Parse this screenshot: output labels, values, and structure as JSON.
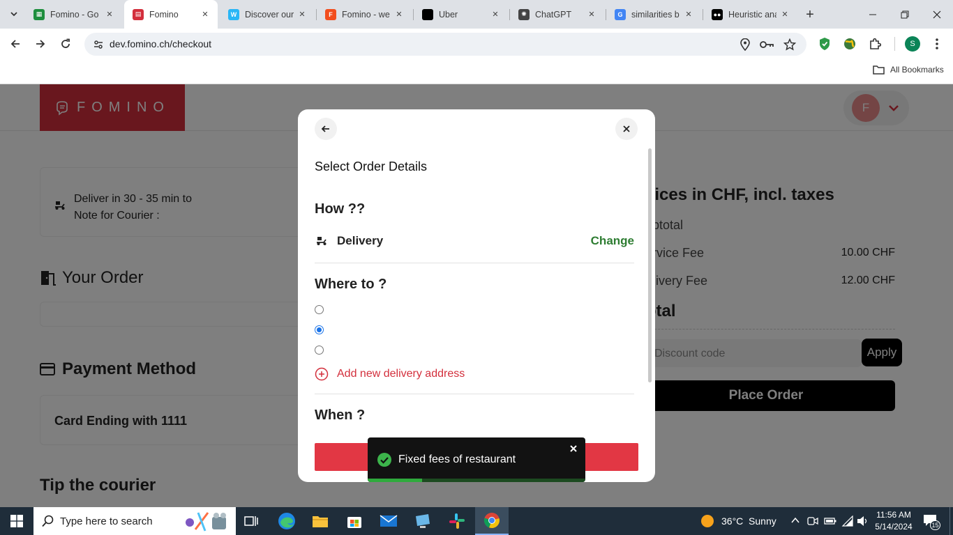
{
  "browser": {
    "tabs": [
      {
        "title": "Fomino - Go",
        "icon": "google-sheets-icon",
        "color": "#1e8e3e",
        "glyph": "▦"
      },
      {
        "title": "Fomino",
        "icon": "fomino-icon",
        "color": "#d32f3c",
        "glyph": "▤"
      },
      {
        "title": "Discover our",
        "icon": "webflow-icon",
        "color": "#29b6f6",
        "glyph": "W"
      },
      {
        "title": "Fomino - we",
        "icon": "figma-icon",
        "color": "#f24e1e",
        "glyph": "F"
      },
      {
        "title": "Uber",
        "icon": "uber-icon",
        "color": "#000000",
        "glyph": ""
      },
      {
        "title": "ChatGPT",
        "icon": "chatgpt-icon",
        "color": "#444444",
        "glyph": "✺"
      },
      {
        "title": "similarities b",
        "icon": "google-icon",
        "color": "#4285f4",
        "glyph": "G"
      },
      {
        "title": "Heuristic ana",
        "icon": "medium-icon",
        "color": "#000000",
        "glyph": "●●"
      }
    ],
    "url": "dev.fomino.ch/checkout",
    "all_bookmarks": "All Bookmarks",
    "profile_initial": "S"
  },
  "site": {
    "logo": "FOMINO",
    "user_initial": "F",
    "deliver_text": "Deliver in 30 - 35 min to",
    "courier_note": "Note for Courier :",
    "your_order": "Your Order",
    "payment_method": "Payment Method",
    "card_text": "Card Ending with 1111",
    "tip_title": "Tip the courier"
  },
  "summary": {
    "title": "Prices in CHF, incl. taxes",
    "subtotal_label": "Subtotal",
    "service_fee_label": "Service Fee",
    "service_fee_value": "10.00 CHF",
    "delivery_fee_label": "Delivery Fee",
    "delivery_fee_value": "12.00 CHF",
    "total_label": "Total",
    "discount_placeholder": "Discount code",
    "apply_label": "Apply",
    "place_order_label": "Place Order"
  },
  "modal": {
    "title": "Select Order Details",
    "how_heading": "How ??",
    "delivery_label": "Delivery",
    "change_label": "Change",
    "where_heading": "Where to ?",
    "addresses": [
      {
        "selected": false
      },
      {
        "selected": true
      },
      {
        "selected": false
      }
    ],
    "add_address_label": "Add new delivery address",
    "when_heading": "When ?"
  },
  "toast": {
    "message": "Fixed fees of restaurant",
    "progress": 0.25
  },
  "taskbar": {
    "search_placeholder": "Type here to search",
    "weather": "36°C  Sunny",
    "time": "11:56 AM",
    "date": "5/14/2024",
    "notification_count": "15"
  },
  "colors": {
    "brand_red": "#d32f3c",
    "green": "#2e7d32",
    "toast_bg": "#121212"
  }
}
